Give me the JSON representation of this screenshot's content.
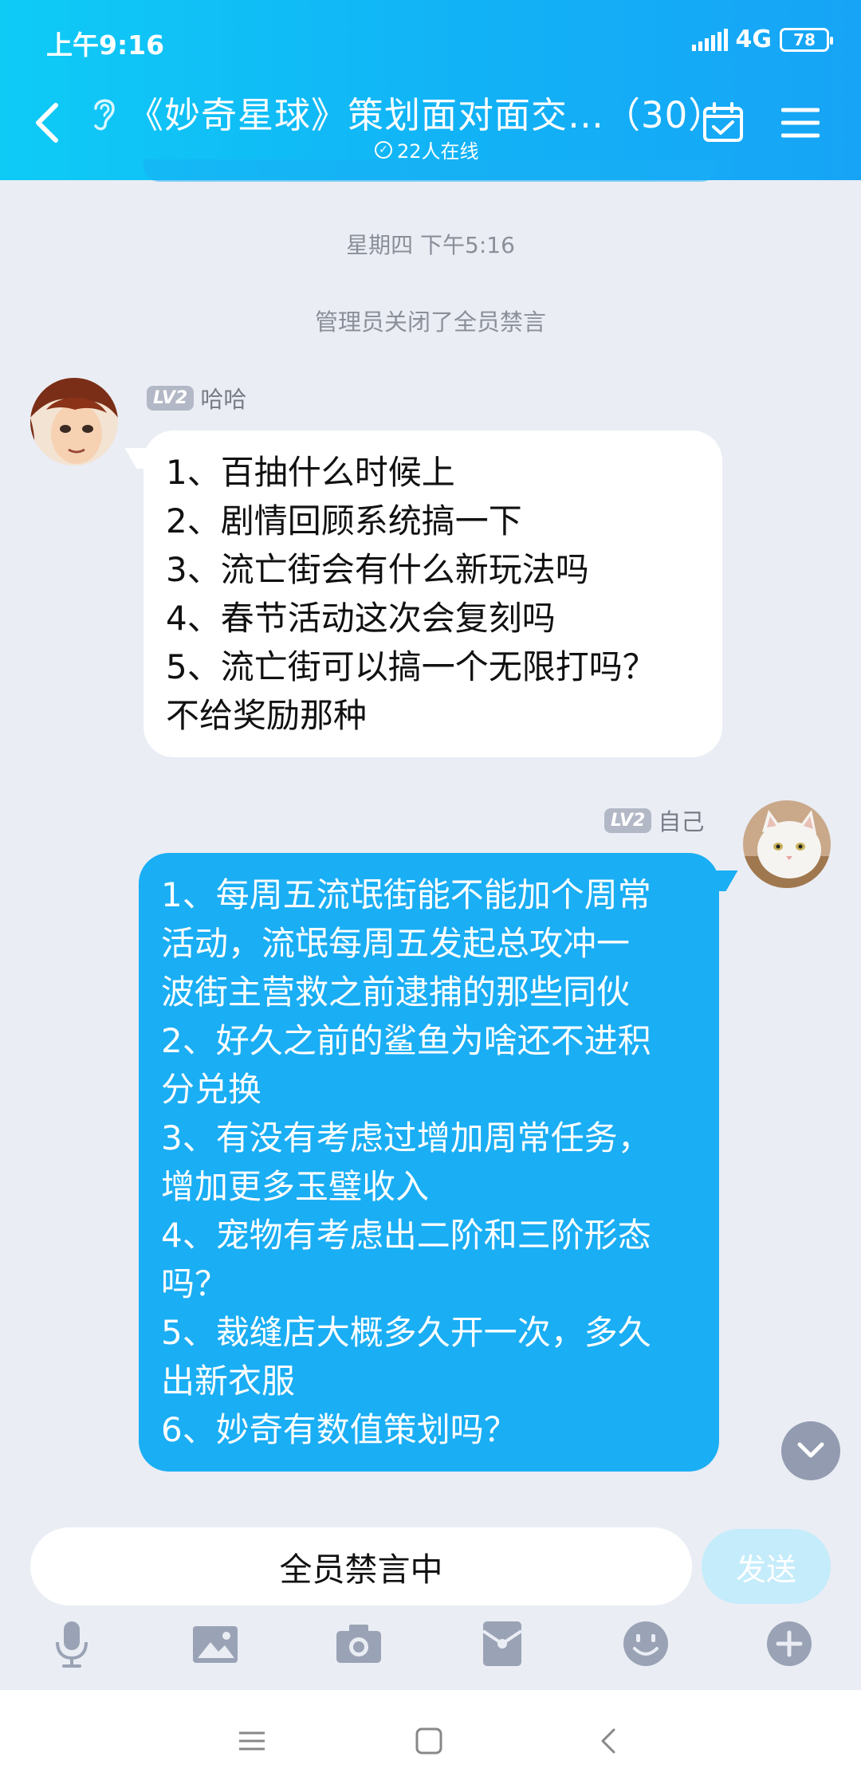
{
  "status_bar": {
    "time": "上午9:16",
    "network": "4G",
    "battery": "78"
  },
  "header": {
    "title": "《妙奇星球》策划面对面交…（30）",
    "online": "22人在线",
    "accent_color": "#12b2f6"
  },
  "chat": {
    "timestamp": "星期四 下午5:16",
    "system_notice": "管理员关闭了全员禁言",
    "messages": [
      {
        "level": "LV2",
        "sender": "哈哈",
        "lines": [
          "1、百抽什么时候上",
          "2、剧情回顾系统搞一下",
          "3、流亡街会有什么新玩法吗",
          "4、春节活动这次会复刻吗",
          "5、流亡街可以搞一个无限打吗？",
          "不给奖励那种"
        ]
      },
      {
        "level": "LV2",
        "sender": "自己",
        "lines": [
          "1、每周五流氓街能不能加个周常",
          "活动，流氓每周五发起总攻冲一",
          "波街主营救之前逮捕的那些同伙",
          "2、好久之前的鲨鱼为啥还不进积",
          "分兑换",
          "3、有没有考虑过增加周常任务，",
          "增加更多玉璧收入",
          "4、宠物有考虑出二阶和三阶形态",
          "吗？",
          "5、裁缝店大概多久开一次，多久",
          "出新衣服",
          "6、妙奇有数值策划吗？"
        ]
      }
    ]
  },
  "input": {
    "placeholder": "全员禁言中",
    "send_label": "发送"
  },
  "toolbar": [
    "microphone-icon",
    "image-icon",
    "camera-icon",
    "red-packet-icon",
    "emoji-icon",
    "plus-icon"
  ]
}
